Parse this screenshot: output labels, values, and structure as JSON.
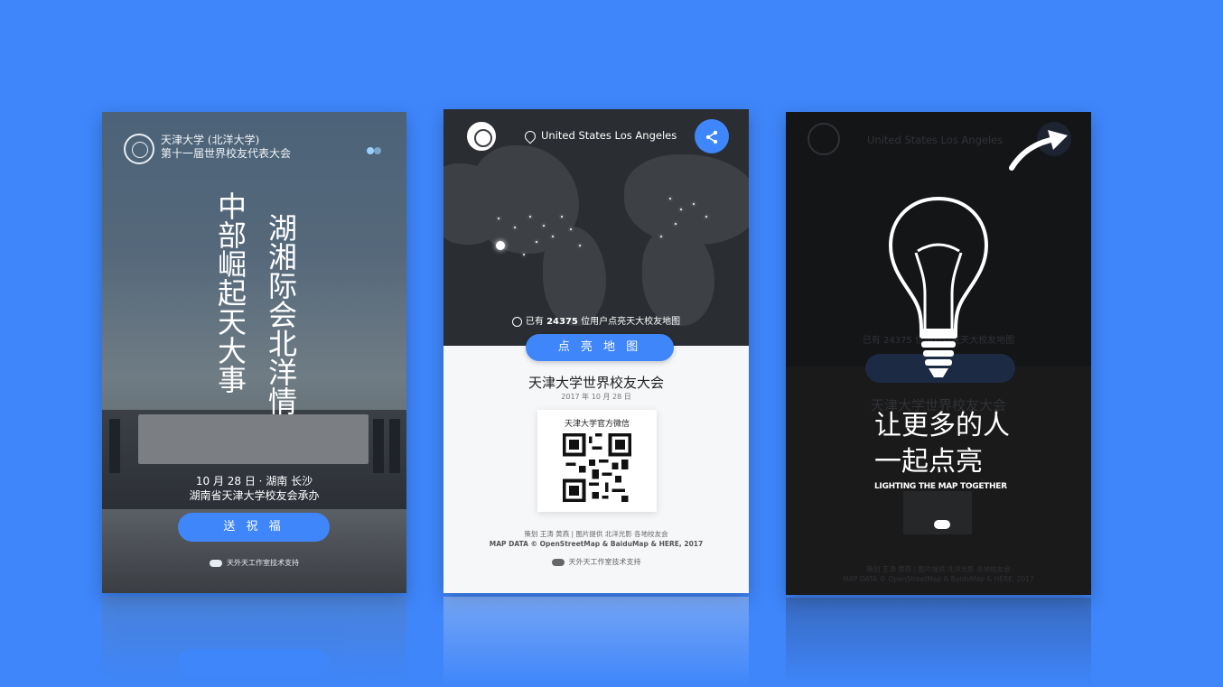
{
  "card1": {
    "header_line1": "天津大学 (北洋大学)",
    "header_line2": "第十一届世界校友代表大会",
    "slogan_left": "中部崛起天大事",
    "slogan_right": "湖湘际会北洋情",
    "date_line": "10 月 28 日 · 湖南 长沙",
    "host_line": "湖南省天津大学校友会承办",
    "button_label": "送 祝 福",
    "credit": "天外天工作室技术支持"
  },
  "card2": {
    "location": "United States Los Angeles",
    "count_prefix": "已有",
    "count_value": "24375",
    "count_suffix": "位用户点亮天大校友地图",
    "button_label": "点 亮 地 图",
    "title": "天津大学世界校友大会",
    "date": "2017 年 10 月 28 日",
    "qr_label": "天津大学官方微信",
    "footer_line1": "策划 王涛 黄燕 | 图片提供 北洋光影 各地校友会",
    "footer_line2": "MAP DATA © OpenStreetMap & BaiduMap & HERE, 2017",
    "credit": "天外天工作室技术支持"
  },
  "card3": {
    "ghost_location": "United States Los Angeles",
    "ghost_count": "已有 24375 位用户点亮天大校友地图",
    "ghost_title": "天津大学世界校友大会",
    "ghost_footer1": "策划 王涛 黄燕 | 图片提供 北洋光影 各地校友会",
    "ghost_footer2": "MAP DATA © OpenStreetMap & BaiduMap & HERE, 2017",
    "line1": "让更多的人",
    "line2": "一起点亮",
    "english": "LIGHTING THE MAP TOGETHER"
  },
  "colors": {
    "background": "#3f86fb",
    "accent": "#3f86fb"
  }
}
